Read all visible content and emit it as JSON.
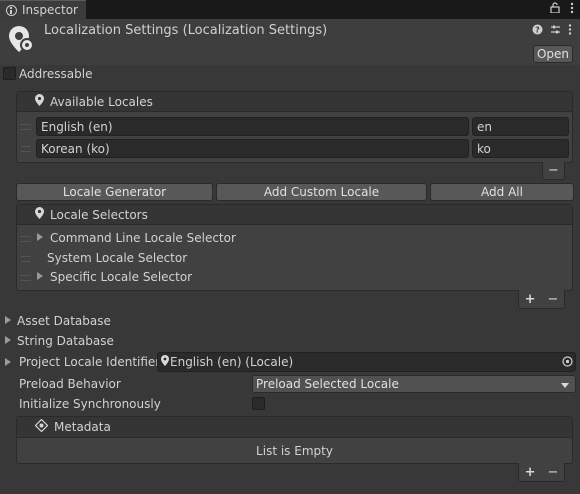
{
  "tab": {
    "label": "Inspector"
  },
  "header": {
    "title": "Localization Settings (Localization Settings)",
    "open_label": "Open"
  },
  "addressable": {
    "label": "Addressable",
    "checked": false
  },
  "available_locales": {
    "header": "Available Locales",
    "rows": [
      {
        "name": "English (en)",
        "code": "en"
      },
      {
        "name": "Korean (ko)",
        "code": "ko"
      }
    ],
    "remove_label": "−"
  },
  "locale_buttons": {
    "generator": "Locale Generator",
    "custom": "Add Custom Locale",
    "add_all": "Add All"
  },
  "locale_selectors": {
    "header": "Locale Selectors",
    "items": [
      "Command Line Locale Selector",
      "System Locale Selector",
      "Specific Locale Selector"
    ],
    "add_label": "+",
    "remove_label": "−"
  },
  "sections": {
    "asset_database": "Asset Database",
    "string_database": "String Database"
  },
  "project_locale": {
    "label": "Project Locale Identifier",
    "value": "English (en) (Locale)"
  },
  "preload": {
    "label": "Preload Behavior",
    "value": "Preload Selected Locale"
  },
  "initialize": {
    "label": "Initialize Synchronously",
    "checked": false
  },
  "metadata": {
    "header": "Metadata",
    "empty": "List is Empty",
    "add_label": "+",
    "remove_label": "−"
  }
}
